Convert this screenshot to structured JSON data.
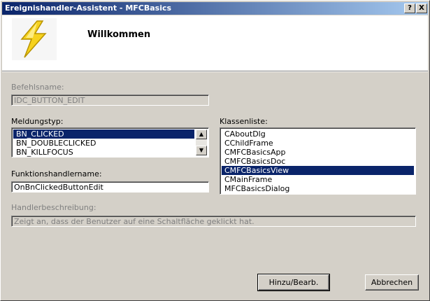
{
  "window": {
    "title": "Ereignishandler-Assistent - MFCBasics",
    "help_button": "?",
    "close_button": "X"
  },
  "banner": {
    "heading": "Willkommen"
  },
  "command_name": {
    "label": "Befehlsname:",
    "value": "IDC_BUTTON_EDIT"
  },
  "message_type": {
    "label": "Meldungstyp:",
    "items": [
      {
        "label": "BN_CLICKED",
        "selected": true
      },
      {
        "label": "BN_DOUBLECLICKED",
        "selected": false
      },
      {
        "label": "BN_KILLFOCUS",
        "selected": false
      }
    ]
  },
  "class_list": {
    "label": "Klassenliste:",
    "items": [
      {
        "label": "CAboutDlg",
        "selected": false
      },
      {
        "label": "CChildFrame",
        "selected": false
      },
      {
        "label": "CMFCBasicsApp",
        "selected": false
      },
      {
        "label": "CMFCBasicsDoc",
        "selected": false
      },
      {
        "label": "CMFCBasicsView",
        "selected": true
      },
      {
        "label": "CMainFrame",
        "selected": false
      },
      {
        "label": "MFCBasicsDialog",
        "selected": false
      }
    ]
  },
  "function_handler": {
    "label": "Funktionshandlername:",
    "value": "OnBnClickedButtonEdit"
  },
  "handler_description": {
    "label": "Handlerbeschreibung:",
    "value": "Zeigt an, dass der Benutzer auf eine Schaltfläche geklickt hat."
  },
  "buttons": {
    "add_edit": "Hinzu/Bearb.",
    "cancel": "Abbrechen"
  },
  "colors": {
    "titlebar_start": "#0a246a",
    "titlebar_end": "#a6caf0",
    "selection": "#0a246a",
    "face": "#d4d0c8"
  }
}
